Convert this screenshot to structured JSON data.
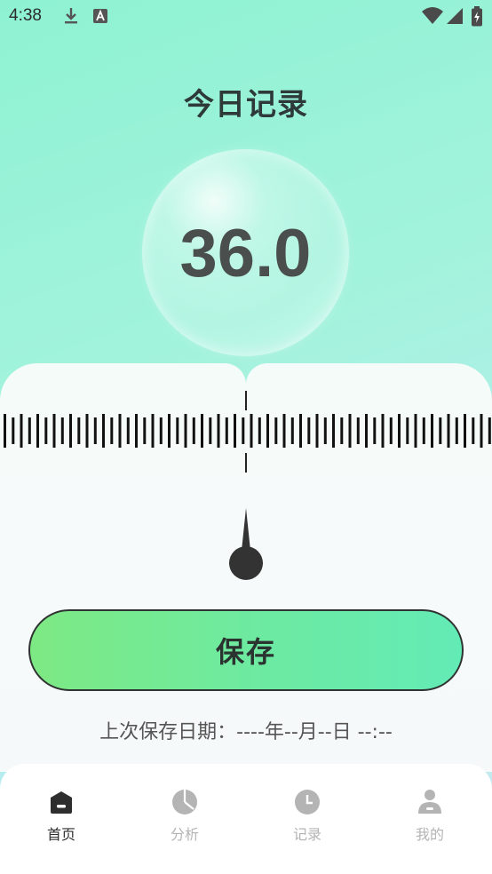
{
  "status_bar": {
    "time": "4:38"
  },
  "header": {
    "title": "今日记录"
  },
  "reading": {
    "value": "36.0"
  },
  "actions": {
    "save_label": "保存"
  },
  "last_saved": {
    "text": "上次保存日期：----年--月--日 --:--"
  },
  "tabs": [
    {
      "label": "首页",
      "icon": "home-icon",
      "active": true
    },
    {
      "label": "分析",
      "icon": "pie-chart-icon",
      "active": false
    },
    {
      "label": "记录",
      "icon": "clock-icon",
      "active": false
    },
    {
      "label": "我的",
      "icon": "profile-icon",
      "active": false
    }
  ],
  "colors": {
    "accent_start": "#7de983",
    "accent_end": "#63ebb6",
    "active_tab": "#2e2e2e",
    "inactive_tab": "#b4b4b4"
  }
}
